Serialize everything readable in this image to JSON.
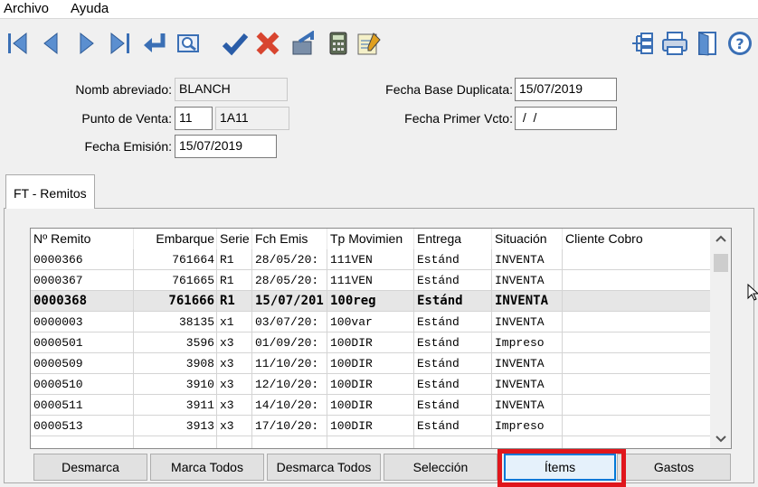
{
  "menu": {
    "archivo": "Archivo",
    "ayuda": "Ayuda"
  },
  "toolbar": {
    "icons": [
      "first-record-icon",
      "prev-record-icon",
      "next-record-icon",
      "last-record-icon",
      "return-icon",
      "preview-icon",
      "confirm-icon",
      "cancel-icon",
      "export-icon",
      "calculator-icon",
      "notes-icon",
      "tree-icon",
      "print-icon",
      "exit-door-icon",
      "help-icon"
    ]
  },
  "form": {
    "nomb_label": "Nomb abreviado:",
    "nomb_value": "BLANCH",
    "punto_label": "Punto de Venta:",
    "punto_value": "11",
    "punto_desc": "1A11",
    "fecha_emision_label": "Fecha Emisión:",
    "fecha_emision_value": "15/07/2019",
    "fecha_base_label": "Fecha Base Duplicata:",
    "fecha_base_value": "15/07/2019",
    "fecha_primer_label": "Fecha Primer Vcto:",
    "fecha_primer_value": " /  /"
  },
  "tab": {
    "label": "FT - Remitos"
  },
  "grid": {
    "headers": [
      "Nº Remito",
      "Embarque",
      "Serie",
      "Fch Emis",
      "Tp Movimien",
      "Entrega",
      "Situación",
      "Cliente Cobro"
    ],
    "rows": [
      [
        "0000366",
        "761664",
        "R1",
        "28/05/20:",
        "111VEN",
        "Estánd",
        "INVENTA",
        ""
      ],
      [
        "0000367",
        "761665",
        "R1",
        "28/05/20:",
        "111VEN",
        "Estánd",
        "INVENTA",
        ""
      ],
      [
        "0000368",
        "761666",
        "R1",
        "15/07/201",
        "100reg",
        "Estánd",
        "INVENTA",
        ""
      ],
      [
        "0000003",
        "38135",
        "x1",
        "03/07/20:",
        "100var",
        "Estánd",
        "INVENTA",
        ""
      ],
      [
        "0000501",
        "3596",
        "x3",
        "01/09/20:",
        "100DIR",
        "Estánd",
        "Impreso",
        ""
      ],
      [
        "0000509",
        "3908",
        "x3",
        "11/10/20:",
        "100DIR",
        "Estánd",
        "INVENTA",
        ""
      ],
      [
        "0000510",
        "3910",
        "x3",
        "12/10/20:",
        "100DIR",
        "Estánd",
        "INVENTA",
        ""
      ],
      [
        "0000511",
        "3911",
        "x3",
        "14/10/20:",
        "100DIR",
        "Estánd",
        "INVENTA",
        ""
      ],
      [
        "0000513",
        "3913",
        "x3",
        "17/10/20:",
        "100DIR",
        "Estánd",
        "Impreso",
        ""
      ]
    ],
    "selected_index": 2
  },
  "buttons": {
    "desmarca": "Desmarca",
    "marca_todos": "Marca Todos",
    "desmarca_todos": "Desmarca Todos",
    "seleccion": "Selección",
    "items": "Ítems",
    "gastos": "Gastos"
  },
  "colors": {
    "highlight": "#e0161c",
    "icon_blue": "#3a6fb5",
    "confirm": "#2a5da8",
    "cancel": "#d8452f"
  }
}
